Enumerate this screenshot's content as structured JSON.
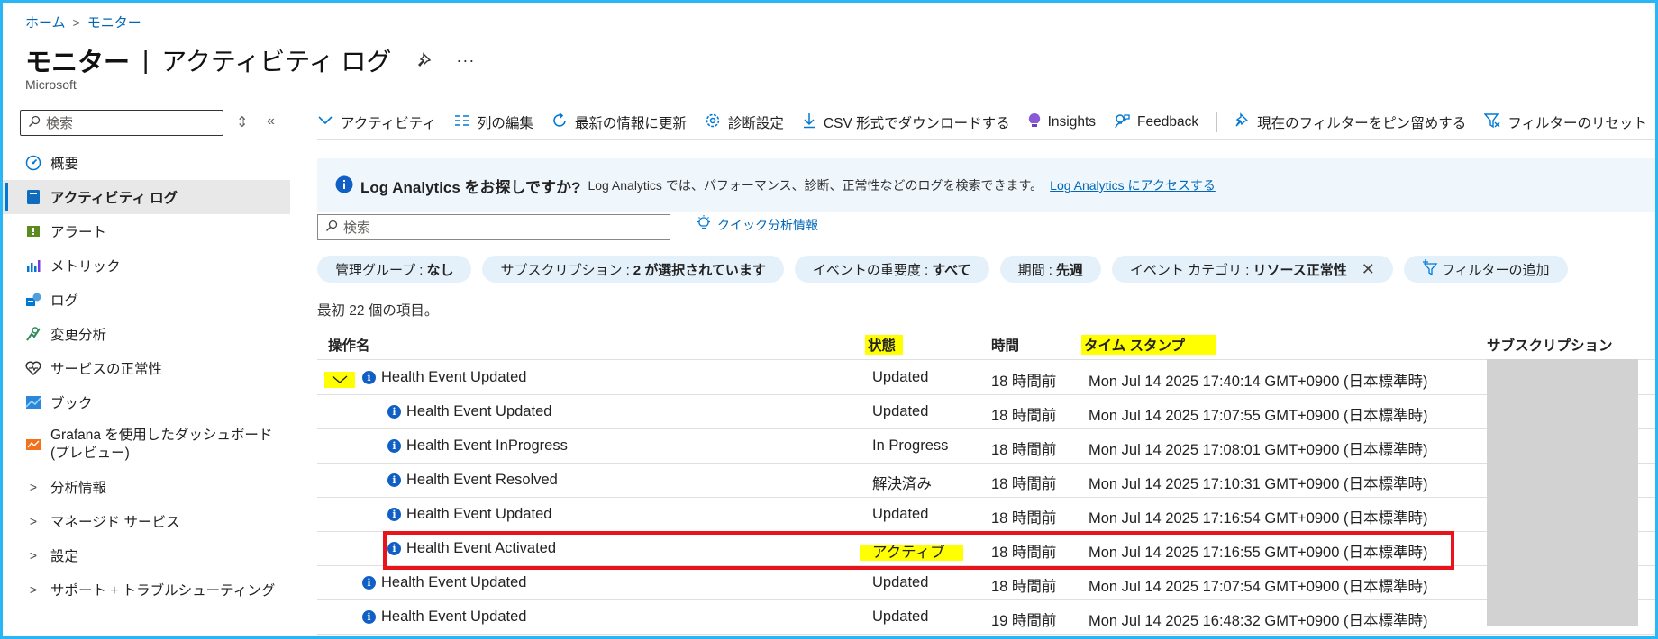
{
  "breadcrumb": [
    "ホーム",
    "モニター"
  ],
  "header": {
    "title": "モニター",
    "subtitle": "アクティビティ ログ",
    "org": "Microsoft",
    "more": "···"
  },
  "sidebar": {
    "search_placeholder": "検索",
    "items": [
      {
        "label": "概要",
        "icon": "gauge-icon"
      },
      {
        "label": "アクティビティ ログ",
        "icon": "log-book-icon",
        "active": true
      },
      {
        "label": "アラート",
        "icon": "alert-icon"
      },
      {
        "label": "メトリック",
        "icon": "metrics-icon"
      },
      {
        "label": "ログ",
        "icon": "logs-icon"
      },
      {
        "label": "変更分析",
        "icon": "change-analysis-icon"
      },
      {
        "label": "サービスの正常性",
        "icon": "heart-icon"
      },
      {
        "label": "ブック",
        "icon": "workbook-icon"
      },
      {
        "label": "Grafana を使用したダッシュボード (プレビュー)",
        "icon": "grafana-icon"
      },
      {
        "label": "分析情報",
        "expandable": true
      },
      {
        "label": "マネージド サービス",
        "expandable": true
      },
      {
        "label": "設定",
        "expandable": true
      },
      {
        "label": "サポート + トラブルシューティング",
        "expandable": true
      }
    ]
  },
  "toolbar": {
    "activity": "アクティビティ",
    "edit_columns": "列の編集",
    "refresh": "最新の情報に更新",
    "diagnostic": "診断設定",
    "download_csv": "CSV 形式でダウンロードする",
    "insights": "Insights",
    "feedback": "Feedback",
    "pin_filters": "現在のフィルターをピン留めする",
    "reset_filters": "フィルターのリセット"
  },
  "banner": {
    "title": "Log Analytics をお探しですか?",
    "text": "Log Analytics では、パフォーマンス、診断、正常性などのログを検索できます。",
    "link": "Log Analytics にアクセスする"
  },
  "search": {
    "placeholder": "検索"
  },
  "quick_insights": "クイック分析情報",
  "filters": [
    {
      "key": "管理グループ : ",
      "value": "なし"
    },
    {
      "key": "サブスクリプション : ",
      "value": "2 が選択されています"
    },
    {
      "key": "イベントの重要度 : ",
      "value": "すべて"
    },
    {
      "key": "期間 : ",
      "value": "先週"
    },
    {
      "key": "イベント カテゴリ : ",
      "value": "リソース正常性",
      "removable": true
    }
  ],
  "add_filter": "フィルターの追加",
  "result_count": "最初 22 個の項目。",
  "table": {
    "columns": {
      "operation": "操作名",
      "status": "状態",
      "time": "時間",
      "timestamp": "タイム スタンプ",
      "subscription": "サブスクリプション"
    },
    "rows": [
      {
        "name": "Health Event Updated",
        "status": "Updated",
        "time": "18 時間前",
        "timestamp": "Mon Jul 14 2025 17:40:14 GMT+0900 (日本標準時)",
        "level": 0,
        "expanded": true
      },
      {
        "name": "Health Event Updated",
        "status": "Updated",
        "time": "18 時間前",
        "timestamp": "Mon Jul 14 2025 17:07:55 GMT+0900 (日本標準時)",
        "level": 1
      },
      {
        "name": "Health Event InProgress",
        "status": "In Progress",
        "time": "18 時間前",
        "timestamp": "Mon Jul 14 2025 17:08:01 GMT+0900 (日本標準時)",
        "level": 1
      },
      {
        "name": "Health Event Resolved",
        "status": "解決済み",
        "time": "18 時間前",
        "timestamp": "Mon Jul 14 2025 17:10:31 GMT+0900 (日本標準時)",
        "level": 1
      },
      {
        "name": "Health Event Updated",
        "status": "Updated",
        "time": "18 時間前",
        "timestamp": "Mon Jul 14 2025 17:16:54 GMT+0900 (日本標準時)",
        "level": 1
      },
      {
        "name": "Health Event Activated",
        "status": "アクティブ",
        "time": "18 時間前",
        "timestamp": "Mon Jul 14 2025 17:16:55 GMT+0900 (日本標準時)",
        "level": 1,
        "highlighted": true
      },
      {
        "name": "Health Event Updated",
        "status": "Updated",
        "time": "18 時間前",
        "timestamp": "Mon Jul 14 2025 17:07:54 GMT+0900 (日本標準時)",
        "level": 0
      },
      {
        "name": "Health Event Updated",
        "status": "Updated",
        "time": "19 時間前",
        "timestamp": "Mon Jul 14 2025 16:48:32 GMT+0900 (日本標準時)",
        "level": 0
      }
    ]
  },
  "colors": {
    "accent": "#0078d4",
    "highlight": "#ffff00",
    "annotation_red": "#e8131b",
    "pill_bg": "#e5f1fa",
    "frame": "#29b6f6"
  }
}
